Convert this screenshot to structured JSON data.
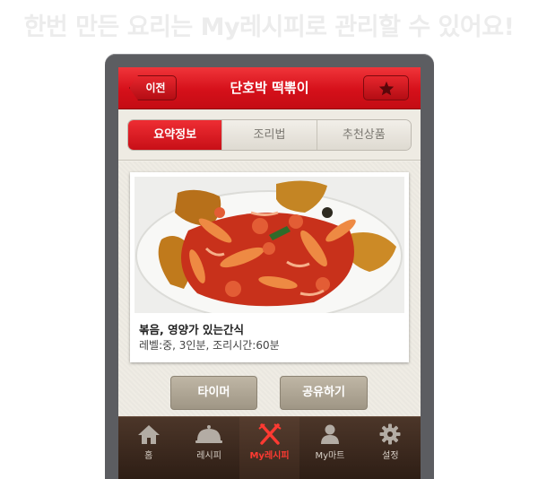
{
  "headline": "한번 만든 요리는 My레시피로 관리할 수 있어요!",
  "header": {
    "back_label": "이전",
    "title": "단호박 떡뽂이"
  },
  "tabs": [
    {
      "label": "요약정보",
      "active": true
    },
    {
      "label": "조리법",
      "active": false
    },
    {
      "label": "추천상품",
      "active": false
    }
  ],
  "recipe": {
    "description": "볶음, 영양가 있는간식",
    "details": "레벨:중, 3인분, 조리시간:60분"
  },
  "actions": {
    "timer_label": "타이머",
    "share_label": "공유하기"
  },
  "nav": [
    {
      "label": "홈",
      "icon": "home-icon"
    },
    {
      "label": "레시피",
      "icon": "cloche-icon"
    },
    {
      "label": "My레시피",
      "icon": "fork-knife-icon",
      "active": true
    },
    {
      "label": "My마트",
      "icon": "person-icon"
    },
    {
      "label": "설정",
      "icon": "gear-icon"
    }
  ],
  "colors": {
    "accent": "#d5101a",
    "nav_bg": "#3b281d",
    "active_nav": "#ff3a32"
  }
}
